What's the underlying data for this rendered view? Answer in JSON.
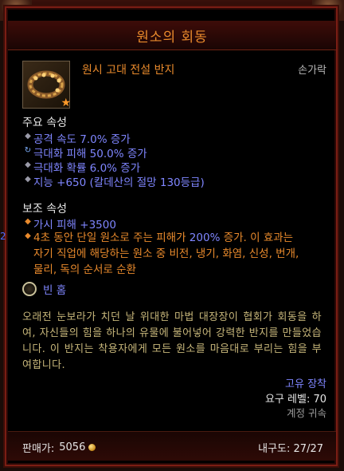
{
  "tooltip": {
    "title": "원소의 회동",
    "item_name": "원시 고대 전설 반지",
    "item_type": "손가락",
    "primary_header": "주요 속성",
    "primary_stats": [
      "공격 속도 7.0% 증가",
      "극대화 피해 50.0% 증가",
      "극대화 확률 6.0% 증가",
      "지능 +650 (칼데산의 절망 130등급)"
    ],
    "secondary_header": "보조 속성",
    "secondary_stats": [
      "가시 피해 +3500"
    ],
    "legendary_power": {
      "line1_part1": "4초 동안 단일 원소로 주는 피해가 ",
      "line1_value": "200%",
      "line1_part2": " 증가. 이 효과는",
      "line2": "자기 직업에 해당하는 원소 중 비전, 냉기, 화염, 신성, 번개,",
      "line3": "물리, 독의 순서로 순환"
    },
    "socket_label": "빈 홈",
    "flavor_text": "오래전 눈보라가 치던 날 위대한 마법 대장장이 협회가 회동을 하여, 자신들의 힘을 하나의 유물에 불어넣어 강력한 반지를 만들었습니다. 이 반지는 착용자에게 모든 원소를 마음대로 부리는 힘을 부여합니다.",
    "set_label": "고유 장착",
    "required_level": "요구 레벨: 70",
    "account_bound": "계정 귀속",
    "sell_label": "판매가:",
    "sell_value": "5056",
    "durability": "내구도: 27/27",
    "side_mark": "2"
  },
  "colors": {
    "legendary_orange": "#e98a2c",
    "magic_blue": "#7f86ff",
    "flavor_gold": "#c7b67a",
    "value_blue": "#7f86ff"
  },
  "icons": {
    "item": "ring-icon",
    "ancient_marker": "star-icon",
    "gold": "gold-coin-icon",
    "socket": "empty-socket-icon"
  }
}
